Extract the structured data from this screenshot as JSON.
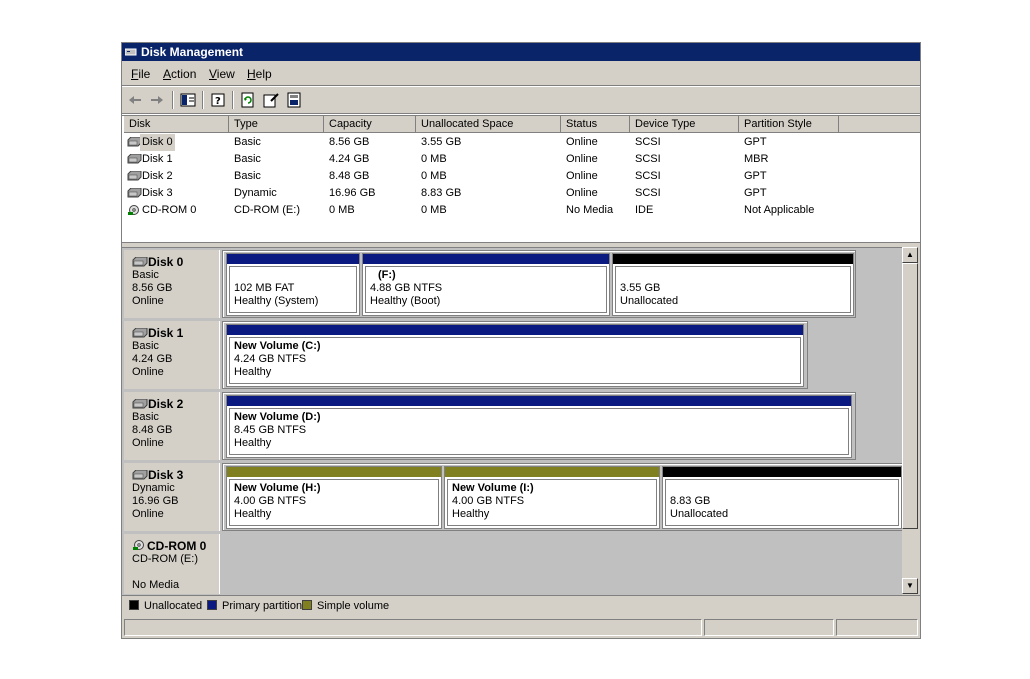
{
  "window": {
    "title": "Disk Management"
  },
  "menu": [
    {
      "label": "File",
      "key": "F",
      "rest": "ile"
    },
    {
      "label": "Action",
      "key": "A",
      "rest": "ction"
    },
    {
      "label": "View",
      "key": "V",
      "rest": "iew"
    },
    {
      "label": "Help",
      "key": "H",
      "rest": "elp"
    }
  ],
  "toolbar": [
    "back-arrow-icon",
    "forward-arrow-icon",
    "show-hide-tree-icon",
    "help-icon",
    "refresh-icon",
    "properties-icon",
    "export-icon"
  ],
  "list": {
    "columns": [
      "Disk",
      "Type",
      "Capacity",
      "Unallocated Space",
      "Status",
      "Device Type",
      "Partition Style"
    ],
    "rows": [
      {
        "disk": "Disk 0",
        "type": "Basic",
        "capacity": "8.56 GB",
        "unalloc": "3.55 GB",
        "status": "Online",
        "device": "SCSI",
        "style": "GPT"
      },
      {
        "disk": "Disk 1",
        "type": "Basic",
        "capacity": "4.24 GB",
        "unalloc": "0 MB",
        "status": "Online",
        "device": "SCSI",
        "style": "MBR"
      },
      {
        "disk": "Disk 2",
        "type": "Basic",
        "capacity": "8.48 GB",
        "unalloc": "0 MB",
        "status": "Online",
        "device": "SCSI",
        "style": "GPT"
      },
      {
        "disk": "Disk 3",
        "type": "Dynamic",
        "capacity": "16.96 GB",
        "unalloc": "8.83 GB",
        "status": "Online",
        "device": "SCSI",
        "style": "GPT"
      },
      {
        "disk": "CD-ROM 0",
        "type": "CD-ROM (E:)",
        "capacity": "0 MB",
        "unalloc": "0 MB",
        "status": "No Media",
        "device": "IDE",
        "style": "Not Applicable"
      }
    ]
  },
  "graph": {
    "disks": [
      {
        "name": "Disk 0",
        "l1": "Basic",
        "l2": "8.56 GB",
        "l3": "Online",
        "parts": [
          {
            "name": "",
            "l1": "102 MB FAT",
            "l2": "Healthy (System)",
            "kind": "primary"
          },
          {
            "name": "(F:)",
            "l1": "4.88 GB NTFS",
            "l2": "Healthy (Boot)",
            "kind": "primary"
          },
          {
            "name": "",
            "l1": "3.55 GB",
            "l2": "Unallocated",
            "kind": "unallocated"
          }
        ]
      },
      {
        "name": "Disk 1",
        "l1": "Basic",
        "l2": "4.24 GB",
        "l3": "Online",
        "parts": [
          {
            "name": "New Volume  (C:)",
            "l1": "4.24 GB NTFS",
            "l2": "Healthy",
            "kind": "primary"
          }
        ]
      },
      {
        "name": "Disk 2",
        "l1": "Basic",
        "l2": "8.48 GB",
        "l3": "Online",
        "parts": [
          {
            "name": "New Volume  (D:)",
            "l1": "8.45 GB NTFS",
            "l2": "Healthy",
            "kind": "primary"
          }
        ]
      },
      {
        "name": "Disk 3",
        "l1": "Dynamic",
        "l2": "16.96 GB",
        "l3": "Online",
        "parts": [
          {
            "name": "New Volume  (H:)",
            "l1": "4.00 GB NTFS",
            "l2": "Healthy",
            "kind": "simple"
          },
          {
            "name": "New Volume  (I:)",
            "l1": "4.00 GB NTFS",
            "l2": "Healthy",
            "kind": "simple"
          },
          {
            "name": "",
            "l1": "8.83 GB",
            "l2": "Unallocated",
            "kind": "unallocated"
          }
        ]
      },
      {
        "name": "CD-ROM 0",
        "l1": "CD-ROM (E:)",
        "l2": "",
        "l3": "No Media",
        "parts": []
      }
    ]
  },
  "legend": [
    {
      "label": "Unallocated",
      "color": "#000000"
    },
    {
      "label": "Primary partition",
      "color": "#0a1a80"
    },
    {
      "label": "Simple volume",
      "color": "#808020"
    }
  ],
  "colors": {
    "primary": "#0a1a80",
    "simple": "#808020",
    "unallocated": "#000000"
  }
}
